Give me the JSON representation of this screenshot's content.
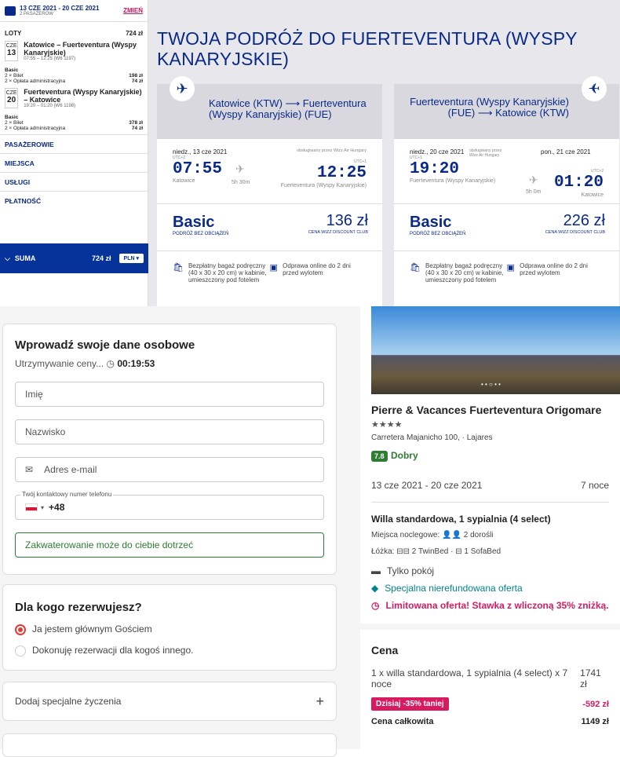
{
  "sidebar": {
    "dates": "13 CZE 2021 - 20 CZE 2021",
    "pax": "2 PASAŻERÓW",
    "change": "ZMIEŃ",
    "flights_label": "LOTY",
    "flights_total": "724 zł",
    "leg1": {
      "mon": "CZE",
      "day": "13",
      "route": "Katowice – Fuerteventura (Wyspy Kanaryjskie)",
      "time": "07:55 – 12:25 (W6 1197)",
      "fare": "Basic",
      "l1": "2 × Bilet",
      "v1": "198 zł",
      "l2": "2 × Opłata administracyjna",
      "v2": "74 zł"
    },
    "leg2": {
      "mon": "CZE",
      "day": "20",
      "route": "Fuerteventura (Wyspy Kanaryjskie) – Katowice",
      "time": "19:20 – 01:20 (W6 1198)",
      "fare": "Basic",
      "l1": "2 × Bilet",
      "v1": "378 zł",
      "l2": "2 × Opłata administracyjna",
      "v2": "74 zł"
    },
    "sections": [
      "PASAŻEROWIE",
      "MIEJSCA",
      "USŁUGI",
      "PŁATNOŚĆ"
    ],
    "sum_label": "SUMA",
    "sum_value": "724 zł",
    "currency": "PLN"
  },
  "main_title": "TWOJA PODRÓŻ DO FUERTEVENTURA (WYSPY KANARYJSKIE)",
  "out": {
    "route": "Katowice (KTW) ⟶ Fuerteventura (Wyspy Kanaryjskie) (FUE)",
    "date": "niedz., 13 cze 2021",
    "op": "obsługiwany przez Wizz Air Hungary",
    "tz1": "UTC+2",
    "tz2": "UTC+1",
    "dep": "07:55",
    "arr": "12:25",
    "dur": "5h 30m",
    "from": "Katowice",
    "to": "Fuerteventura (Wyspy Kanaryjskie)",
    "fare": "Basic",
    "fare_sub": "PODRÓŻ BEZ OBCIĄŻEŃ",
    "price": "136 zł",
    "price_sub": "CENA WIZZ DISCOUNT CLUB",
    "f1": "Bezpłatny bagaż podręczny (40 x 30 x 20 cm) w kabinie, umieszczony pod fotelem",
    "f2": "Odprawa online do 2 dni przed wylotem"
  },
  "ret": {
    "route": "Fuerteventura (Wyspy Kanaryjskie) (FUE) ⟶ Katowice (KTW)",
    "date": "niedz., 20 cze 2021",
    "date2": "pon., 21 cze 2021",
    "op": "obsługiwany przez Wizz Air Hungary",
    "tz1": "UTC+1",
    "tz2": "UTC+2",
    "dep": "19:20",
    "arr": "01:20",
    "dur": "5h 0m",
    "from": "Fuerteventura (Wyspy Kanaryjskie)",
    "to": "Katowice",
    "fare": "Basic",
    "fare_sub": "PODRÓŻ BEZ OBCIĄŻEŃ",
    "price": "226 zł",
    "price_sub": "CENA WIZZ DISCOUNT CLUB",
    "f1": "Bezpłatny bagaż podręczny (40 x 30 x 20 cm) w kabinie, umieszczony pod fotelem",
    "f2": "Odprawa online do 2 dni przed wylotem"
  },
  "form": {
    "title": "Wprowadź swoje dane osobowe",
    "hold": "Utrzymywanie ceny...",
    "timer": "00:19:53",
    "first": "Imię",
    "last": "Nazwisko",
    "email": "Adres e-mail",
    "phone_label": "Twój kontaktowy numer telefonu",
    "phone_code": "+48",
    "note": "Zakwaterowanie może do ciebie dotrzeć",
    "who_title": "Dla kogo rezerwujesz?",
    "opt1": "Ja jestem głównym Gościem",
    "opt2": "Dokonuję rezerwacji dla kogoś innego.",
    "special": "Dodaj specjalne życzenia",
    "plus": "+"
  },
  "hotel": {
    "name": "Pierre & Vacances Fuerteventura Origomare",
    "stars": "★★★★",
    "address": "Carretera Majanicho 100, · Lajares",
    "score": "7.8",
    "score_label": "Dobry",
    "dates": "13 cze 2021 - 20 cze 2021",
    "nights": "7 noce",
    "room": "Willa standardowa, 1 sypialnia (4 select)",
    "beds_label": "Miejsca noclegowe:",
    "beds": "2 dorośli",
    "lozka_label": "Łóżka:",
    "lozka1": "2 TwinBed",
    "lozka2": "1 SofaBed",
    "only_room": "Tylko pokój",
    "offer": "Specjalna nierefundowana oferta",
    "limited": "Limitowana oferta! Stawka z wliczoną 35% zniżką.",
    "price_title": "Cena",
    "line": "1 x willa standardowa, 1 sypialnia (4 select) x 7 noce",
    "line_val": "1741 zł",
    "disc": "Dzisiaj -35% taniej",
    "disc_val": "-592 zł",
    "total": "Cena całkowita",
    "total_val": "1149 zł"
  }
}
